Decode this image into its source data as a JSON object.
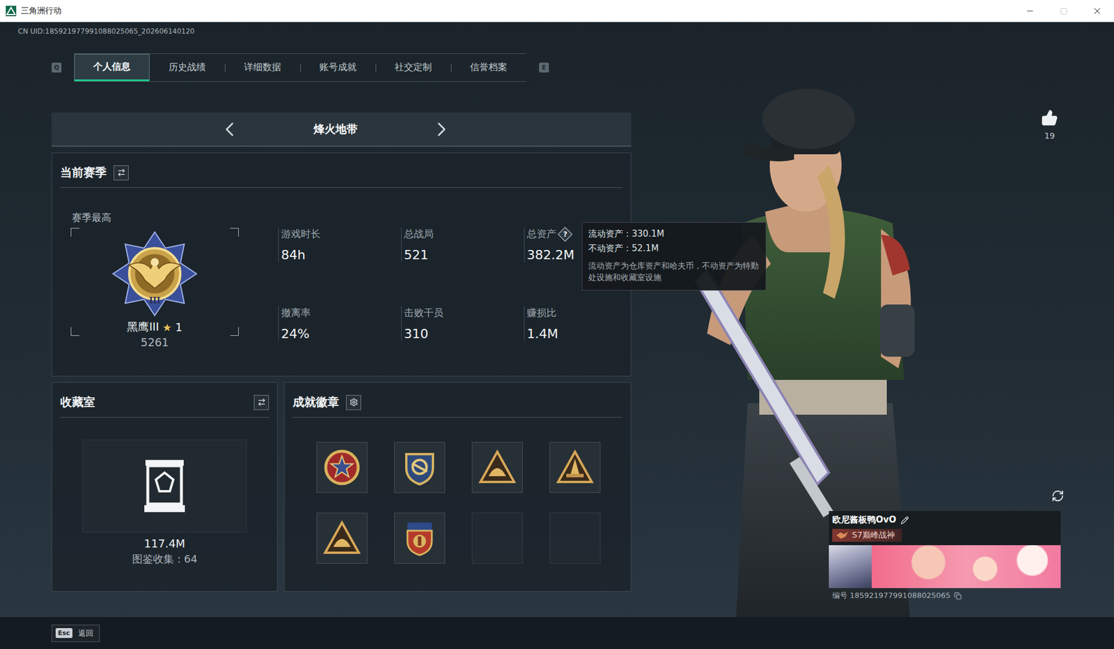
{
  "window": {
    "title": "三角洲行动",
    "maximize_enabled": false
  },
  "uid": "CN UID:185921977991088025065_202606140120",
  "tab_keys": {
    "prev": "Q",
    "next": "E"
  },
  "tabs": [
    {
      "label": "个人信息",
      "selected": true
    },
    {
      "label": "历史战绩",
      "selected": false
    },
    {
      "label": "详细数据",
      "selected": false
    },
    {
      "label": "账号成就",
      "selected": false
    },
    {
      "label": "社交定制",
      "selected": false
    },
    {
      "label": "信誉档案",
      "selected": false
    }
  ],
  "mode": {
    "title": "烽火地带"
  },
  "season": {
    "title": "当前赛季",
    "best_label": "赛季最高",
    "emblem_numeral": "III",
    "rank": "黑鹰III",
    "star": "★",
    "star_count": "1",
    "score": "5261",
    "stats": [
      {
        "label": "游戏时长",
        "value": "84h"
      },
      {
        "label": "总战局",
        "value": "521"
      },
      {
        "label": "总资产",
        "value": "382.2M",
        "help": "?"
      },
      {
        "label": "撤离率",
        "value": "24%"
      },
      {
        "label": "击败干员",
        "value": "310"
      },
      {
        "label": "赚损比",
        "value": "1.4M"
      }
    ]
  },
  "tooltip": {
    "lines": [
      "流动资产：330.1M",
      "不动资产：52.1M"
    ],
    "note": "流动资产为仓库资产和哈夫币，不动资产为特勤处设施和收藏室设施"
  },
  "collection": {
    "title": "收藏室",
    "value": "117.4M",
    "catalog": "图鉴收集：64"
  },
  "achievements": {
    "title": "成就徽章",
    "badges": [
      {
        "kind": "star"
      },
      {
        "kind": "shield"
      },
      {
        "kind": "triangle"
      },
      {
        "kind": "spire"
      },
      {
        "kind": "triangle"
      },
      {
        "kind": "crest"
      },
      {
        "kind": "empty"
      },
      {
        "kind": "empty"
      }
    ]
  },
  "likes": "19",
  "profile": {
    "name": "欧尼酱板鸭OvO",
    "title": "S7巅峰战神",
    "id": "编号 185921977991088025065"
  },
  "footer": {
    "key": "Esc",
    "label": "返回"
  }
}
